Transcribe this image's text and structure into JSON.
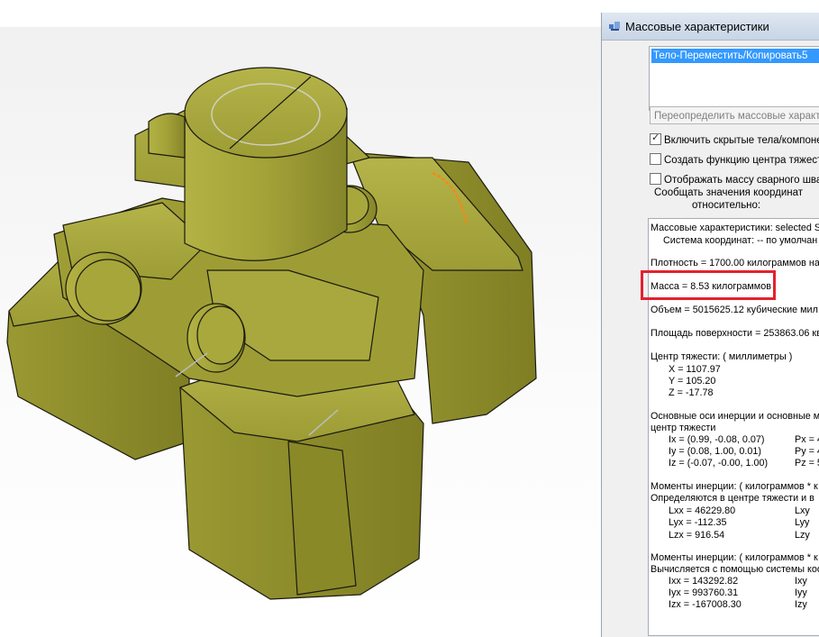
{
  "dialog": {
    "title": "Массовые характеристики",
    "selected_item": "Тело-Переместить/Копировать5",
    "override_button": "Переопределить массовые характер",
    "checkboxes": [
      {
        "label": "Включить скрытые тела/компонен",
        "checked": true
      },
      {
        "label": "Создать функцию центра тяжести",
        "checked": false
      },
      {
        "label": "Отображать массу сварного шва",
        "checked": false
      }
    ],
    "report_relative_line1": "Сообщать значения координат",
    "report_relative_line2": "относительно:"
  },
  "results": {
    "header1": "Массовые характеристики: selected S",
    "header2": "Система координат: -- по умолчан",
    "density": "Плотность = 1700.00 килограммов на",
    "mass": "Масса = 8.53 килограммов",
    "volume": "Объем = 5015625.12  кубические мил",
    "surface_area": "Площадь поверхности = 253863.06  кв",
    "cog_title": "Центр тяжести: ( миллиметры )",
    "cog_x": "X = 1107.97",
    "cog_y": "Y = 105.20",
    "cog_z": "Z = -17.78",
    "principal_title1": "Основные оси инерции и основные мо",
    "principal_title2": "центр тяжести",
    "ix": "Ix = (0.99, -0.08, 0.07)",
    "iy": "Iy = (0.08, 1.00, 0.01)",
    "iz": "Iz = (-0.07, -0.00, 1.00)",
    "px": "Px = 4",
    "py": "Py = 4",
    "pz": "Pz = 5",
    "moments1_title1": "Моменты инерции: ( килограммов * к",
    "moments1_title2": "Определяются в центре тяжести и в",
    "lxx": "Lxx = 46229.80",
    "lyx": "Lyx = -112.35",
    "lzx": "Lzx = 916.54",
    "lxy": "Lxy",
    "lyy": "Lyy",
    "lzy": "Lzy",
    "moments2_title1": "Моменты инерции: ( килограммов * к",
    "moments2_title2": "Вычисляется с помощью системы коо",
    "ixx": "Ixx = 143292.82",
    "iyx": "Iyx = 993760.31",
    "izx": "Izx = -167008.30",
    "ixy": "Ixy",
    "iyy": "Iyy",
    "izy": "Izy"
  },
  "colors": {
    "model_face": "#a3a238",
    "model_side": "#8e8d2c",
    "model_edge": "#1a1a10",
    "selection": "#3399ff",
    "highlight": "#e4202e"
  }
}
